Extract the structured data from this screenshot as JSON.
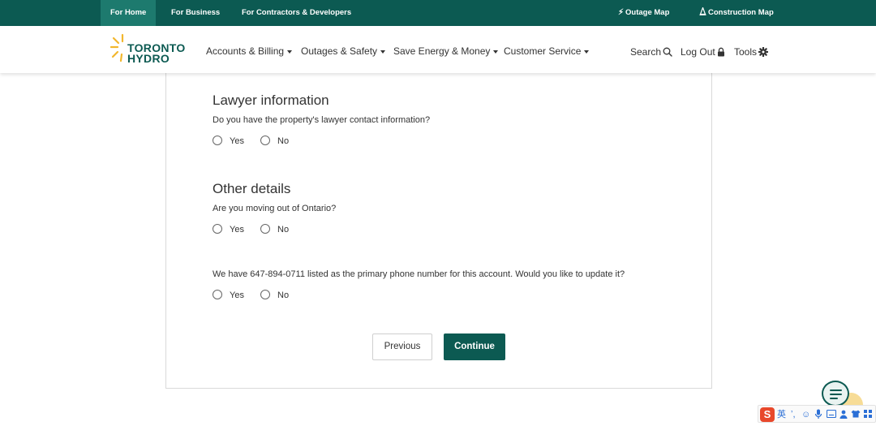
{
  "topbar": {
    "links": [
      "For Home",
      "For Business",
      "For Contractors & Developers"
    ],
    "outage_map": "Outage Map",
    "construction_map": "Construction Map"
  },
  "header": {
    "logo_line1": "TORONTO",
    "logo_line2": "HYDRO",
    "nav": [
      "Accounts & Billing",
      "Outages & Safety",
      "Save Energy & Money",
      "Customer Service"
    ],
    "search": "Search",
    "logout": "Log Out",
    "tools": "Tools"
  },
  "form": {
    "lawyer": {
      "title": "Lawyer information",
      "question": "Do you have the property's lawyer contact information?"
    },
    "other": {
      "title": "Other details",
      "question": "Are you moving out of Ontario?"
    },
    "phone": {
      "question": "We have 647-894-0711 listed as the primary phone number for this account. Would you like to update it?"
    },
    "options": {
      "yes": "Yes",
      "no": "No"
    },
    "buttons": {
      "previous": "Previous",
      "continue": "Continue"
    }
  },
  "ime": {
    "logo": "S",
    "lang": "英"
  },
  "colors": {
    "brand_green": "#0c5a52",
    "active_tab": "#1d7a6e",
    "logo_yellow": "#f2b72d"
  }
}
